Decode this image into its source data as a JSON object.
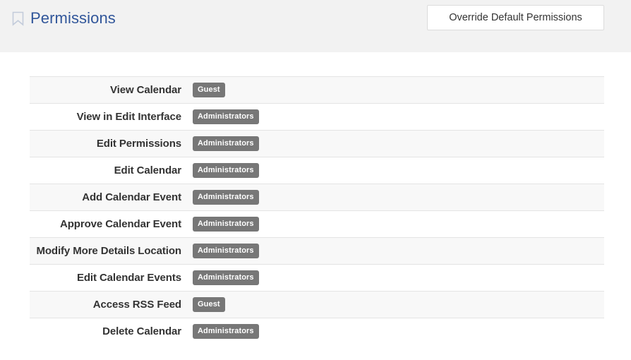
{
  "header": {
    "icon": "bookmark-icon",
    "title": "Permissions",
    "title_color": "#31569a",
    "background_color": "#f2f2f2",
    "override_button_label": "Override Default Permissions"
  },
  "table": {
    "badge_color": "#777777",
    "stripe_color": "#f8f8f8",
    "rows": [
      {
        "label": "View Calendar",
        "badge": "Guest"
      },
      {
        "label": "View in Edit Interface",
        "badge": "Administrators"
      },
      {
        "label": "Edit Permissions",
        "badge": "Administrators"
      },
      {
        "label": "Edit Calendar",
        "badge": "Administrators"
      },
      {
        "label": "Add Calendar Event",
        "badge": "Administrators"
      },
      {
        "label": "Approve Calendar Event",
        "badge": "Administrators"
      },
      {
        "label": "Modify More Details Location",
        "badge": "Administrators"
      },
      {
        "label": "Edit Calendar Events",
        "badge": "Administrators"
      },
      {
        "label": "Access RSS Feed",
        "badge": "Guest"
      },
      {
        "label": "Delete Calendar",
        "badge": "Administrators"
      }
    ]
  }
}
